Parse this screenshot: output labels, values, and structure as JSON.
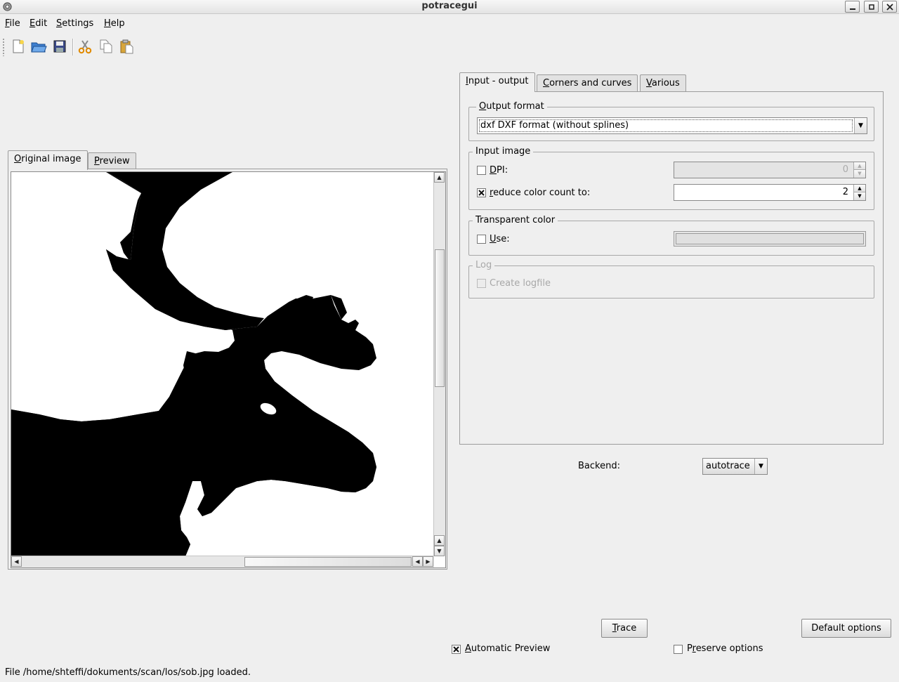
{
  "window": {
    "title": "potracegui"
  },
  "menu": {
    "items": [
      {
        "label": "File",
        "mnemonic": "F",
        "rest": "ile"
      },
      {
        "label": "Edit",
        "mnemonic": "E",
        "rest": "dit"
      },
      {
        "label": "Settings",
        "mnemonic": "S",
        "rest": "ettings"
      },
      {
        "label": "Help",
        "mnemonic": "H",
        "rest": "elp"
      }
    ]
  },
  "toolbar": {
    "icons": [
      "new-document-icon",
      "open-folder-icon",
      "save-icon",
      "cut-icon",
      "copy-icon",
      "paste-icon"
    ]
  },
  "left_tabs": [
    {
      "mnemonic": "O",
      "rest": "riginal image",
      "active": true
    },
    {
      "mnemonic": "P",
      "rest": "review",
      "active": false
    }
  ],
  "right_tabs": [
    {
      "mnemonic": "I",
      "rest": "nput - output",
      "active": true
    },
    {
      "mnemonic": "C",
      "rest": "orners and curves",
      "active": false
    },
    {
      "mnemonic": "V",
      "rest": "arious",
      "active": false
    }
  ],
  "output_format": {
    "legend_mnemonic": "O",
    "legend_rest": "utput format",
    "selected": "dxf DXF format (without splines)"
  },
  "input_image": {
    "legend": "Input image",
    "dpi": {
      "mnemonic": "D",
      "rest": "PI:",
      "checked": false,
      "value": "0"
    },
    "reduce": {
      "mnemonic": "r",
      "rest": "educe color count to:",
      "checked": true,
      "value": "2"
    }
  },
  "transparent_color": {
    "legend": "Transparent color",
    "use": {
      "mnemonic": "U",
      "rest": "se:",
      "checked": false
    }
  },
  "log": {
    "legend": "Log",
    "create_logfile": {
      "label": "Create logfile",
      "checked": false
    }
  },
  "backend": {
    "label": "Backend:",
    "value": "autotrace"
  },
  "actions": {
    "trace": {
      "mnemonic": "T",
      "rest": "race"
    },
    "default_options": {
      "before": "Default options",
      "label": "Default options"
    }
  },
  "options": {
    "automatic_preview": {
      "mnemonic": "A",
      "rest": "utomatic Preview",
      "checked": true
    },
    "preserve_options": {
      "before": "P",
      "mnemonic": "r",
      "rest": "eserve options",
      "checked": false
    }
  },
  "status": {
    "message": "File /home/shteffi/dokuments/scan/los/sob.jpg loaded."
  },
  "colors": {
    "background": "#efefef",
    "image_fill": "#000000"
  }
}
